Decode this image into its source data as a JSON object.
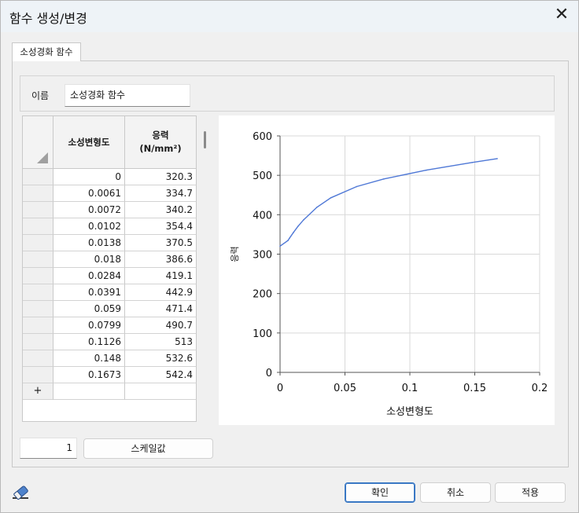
{
  "window": {
    "title": "함수 생성/변경"
  },
  "tab": {
    "label": "소성경화 함수"
  },
  "name": {
    "label": "이름",
    "value": "소성경화 함수"
  },
  "table": {
    "col1_header": "소성변형도",
    "col2_header_line1": "응력",
    "col2_header_line2": "(N/mm²)",
    "add_row_label": "+",
    "rows": [
      {
        "strain": "0",
        "stress": "320.3"
      },
      {
        "strain": "0.0061",
        "stress": "334.7"
      },
      {
        "strain": "0.0072",
        "stress": "340.2"
      },
      {
        "strain": "0.0102",
        "stress": "354.4"
      },
      {
        "strain": "0.0138",
        "stress": "370.5"
      },
      {
        "strain": "0.018",
        "stress": "386.6"
      },
      {
        "strain": "0.0284",
        "stress": "419.1"
      },
      {
        "strain": "0.0391",
        "stress": "442.9"
      },
      {
        "strain": "0.059",
        "stress": "471.4"
      },
      {
        "strain": "0.0799",
        "stress": "490.7"
      },
      {
        "strain": "0.1126",
        "stress": "513"
      },
      {
        "strain": "0.148",
        "stress": "532.6"
      },
      {
        "strain": "0.1673",
        "stress": "542.4"
      }
    ]
  },
  "scale": {
    "value": "1",
    "button_label": "스케일값"
  },
  "buttons": {
    "ok": "확인",
    "cancel": "취소",
    "apply": "적용"
  },
  "colors": {
    "line": "#4f78d6",
    "grid": "#d9d9d9",
    "accent": "#3a78c4"
  },
  "chart_data": {
    "type": "line",
    "xlabel": "소성변형도",
    "ylabel": "응력",
    "xlim": [
      0,
      0.2
    ],
    "ylim": [
      0,
      600
    ],
    "x_ticks": [
      "0",
      "0.05",
      "0.1",
      "0.15",
      "0.2"
    ],
    "y_ticks": [
      "0",
      "100",
      "200",
      "300",
      "400",
      "500",
      "600"
    ],
    "grid": true,
    "series": [
      {
        "x": [
          0,
          0.0061,
          0.0072,
          0.0102,
          0.0138,
          0.018,
          0.0284,
          0.0391,
          0.059,
          0.0799,
          0.1126,
          0.148,
          0.1673
        ],
        "y": [
          320.3,
          334.7,
          340.2,
          354.4,
          370.5,
          386.6,
          419.1,
          442.9,
          471.4,
          490.7,
          513,
          532.6,
          542.4
        ]
      }
    ]
  }
}
